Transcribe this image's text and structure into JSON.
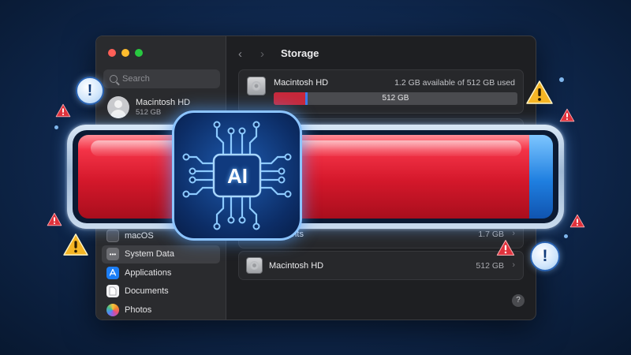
{
  "window": {
    "title": "Storage",
    "nav": {
      "back": "‹",
      "forward": "›"
    }
  },
  "sidebar": {
    "search": {
      "placeholder": "Search",
      "value": ""
    },
    "account": {
      "name": "Macintosh HD",
      "subtitle": "512 GB"
    },
    "items": [
      {
        "label": "macOS",
        "icon": "macos-icon"
      },
      {
        "label": "System Data",
        "icon": "system-data-icon",
        "active": true
      },
      {
        "label": "Applications",
        "icon": "applications-icon"
      },
      {
        "label": "Documents",
        "icon": "documents-icon"
      },
      {
        "label": "Photos",
        "icon": "photos-icon"
      }
    ]
  },
  "main": {
    "disk": {
      "name": "Macintosh HD",
      "available": "1.2 GB available of 512 GB used",
      "bar_label": "512 GB",
      "used_fraction": 0.13,
      "marker_fraction": 0.13
    },
    "rows": [
      {
        "label": "ments",
        "size": "1.7 GB",
        "chevron": "›"
      },
      {
        "label": "Macintosh HD",
        "size": "512 GB",
        "chevron": "›"
      }
    ],
    "help": "?"
  },
  "overlay": {
    "storage_fill_fraction": 0.95,
    "chip_label": "AI",
    "warning_mark": "!",
    "colors": {
      "red": "#d4182b",
      "blue": "#1f7fe0",
      "warning_yellow": "#f5b524",
      "warning_red": "#e0323c"
    }
  }
}
